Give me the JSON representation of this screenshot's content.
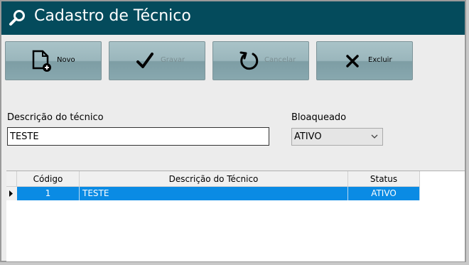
{
  "window": {
    "title": "Cadastro de Técnico"
  },
  "toolbar": {
    "novo": {
      "label": "Novo",
      "icon": "new-document-icon",
      "enabled": true
    },
    "gravar": {
      "label": "Gravar",
      "icon": "checkmark-icon",
      "enabled": false
    },
    "cancelar": {
      "label": "Cancelar",
      "icon": "refresh-icon",
      "enabled": false
    },
    "excluir": {
      "label": "Excluir",
      "icon": "close-icon",
      "enabled": true
    }
  },
  "form": {
    "descricao_label": "Descrição do técnico",
    "descricao_value": "TESTE",
    "bloqueado_label": "Bloaqueado",
    "bloqueado_value": "ATIVO"
  },
  "grid": {
    "columns": [
      "Código",
      "Descrição do Técnico",
      "Status"
    ],
    "rows": [
      {
        "codigo": "1",
        "descricao": "TESTE",
        "status": "ATIVO",
        "selected": true
      }
    ]
  },
  "colors": {
    "titlebar": "#044b5c",
    "selection": "#0a8be4"
  }
}
